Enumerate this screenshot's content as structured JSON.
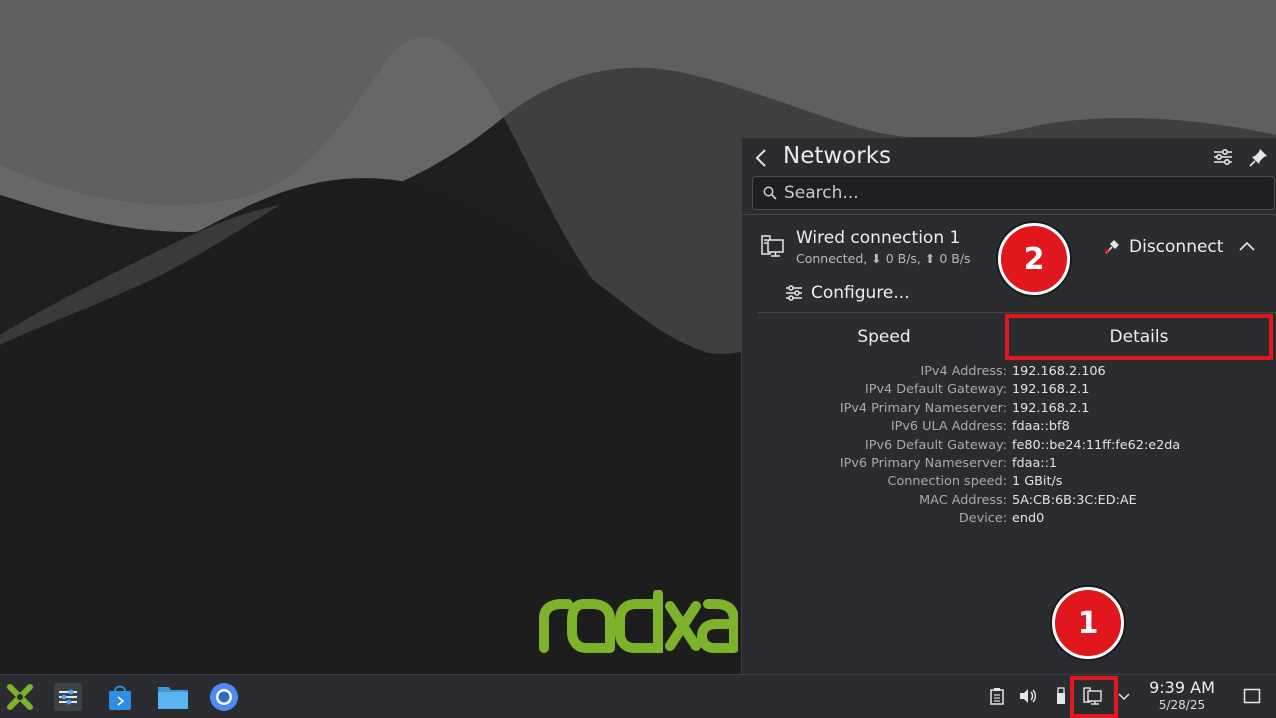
{
  "popup": {
    "title": "Networks",
    "search_placeholder": "Search...",
    "connection": {
      "name": "Wired connection 1",
      "status": "Connected, ⬇ 0 B/s, ⬆ 0 B/s",
      "disconnect_label": "Disconnect",
      "configure_label": "Configure..."
    },
    "tabs": [
      {
        "label": "Speed",
        "selected": false
      },
      {
        "label": "Details",
        "selected": true
      }
    ],
    "details": [
      {
        "label": "IPv4 Address:",
        "value": "192.168.2.106"
      },
      {
        "label": "IPv4 Default Gateway:",
        "value": "192.168.2.1"
      },
      {
        "label": "IPv4 Primary Nameserver:",
        "value": "192.168.2.1"
      },
      {
        "label": "IPv6 ULA Address:",
        "value": "fdaa::bf8"
      },
      {
        "label": "IPv6 Default Gateway:",
        "value": "fe80::be24:11ff:fe62:e2da"
      },
      {
        "label": "IPv6 Primary Nameserver:",
        "value": "fdaa::1"
      },
      {
        "label": "Connection speed:",
        "value": "1 GBit/s"
      },
      {
        "label": "MAC Address:",
        "value": "5A:CB:6B:3C:ED:AE"
      },
      {
        "label": "Device:",
        "value": "end0"
      }
    ]
  },
  "annotations": {
    "badge_1": "1",
    "badge_2": "2"
  },
  "wallpaper": {
    "logo_text": "radxa",
    "logo_color": "#7cb32b"
  },
  "taskbar": {
    "launchers": [
      "app-launcher-icon",
      "system-settings-icon",
      "discover-store-icon",
      "file-manager-icon",
      "chromium-icon"
    ],
    "tray": [
      "clipboard-icon",
      "volume-icon",
      "removable-device-icon",
      "network-wired-icon",
      "tray-expand-icon"
    ],
    "clock": {
      "time": "9:39 AM",
      "date": "5/28/25"
    }
  },
  "colors": {
    "accent_red": "#e0171d",
    "panel_bg": "#2a2c30"
  }
}
